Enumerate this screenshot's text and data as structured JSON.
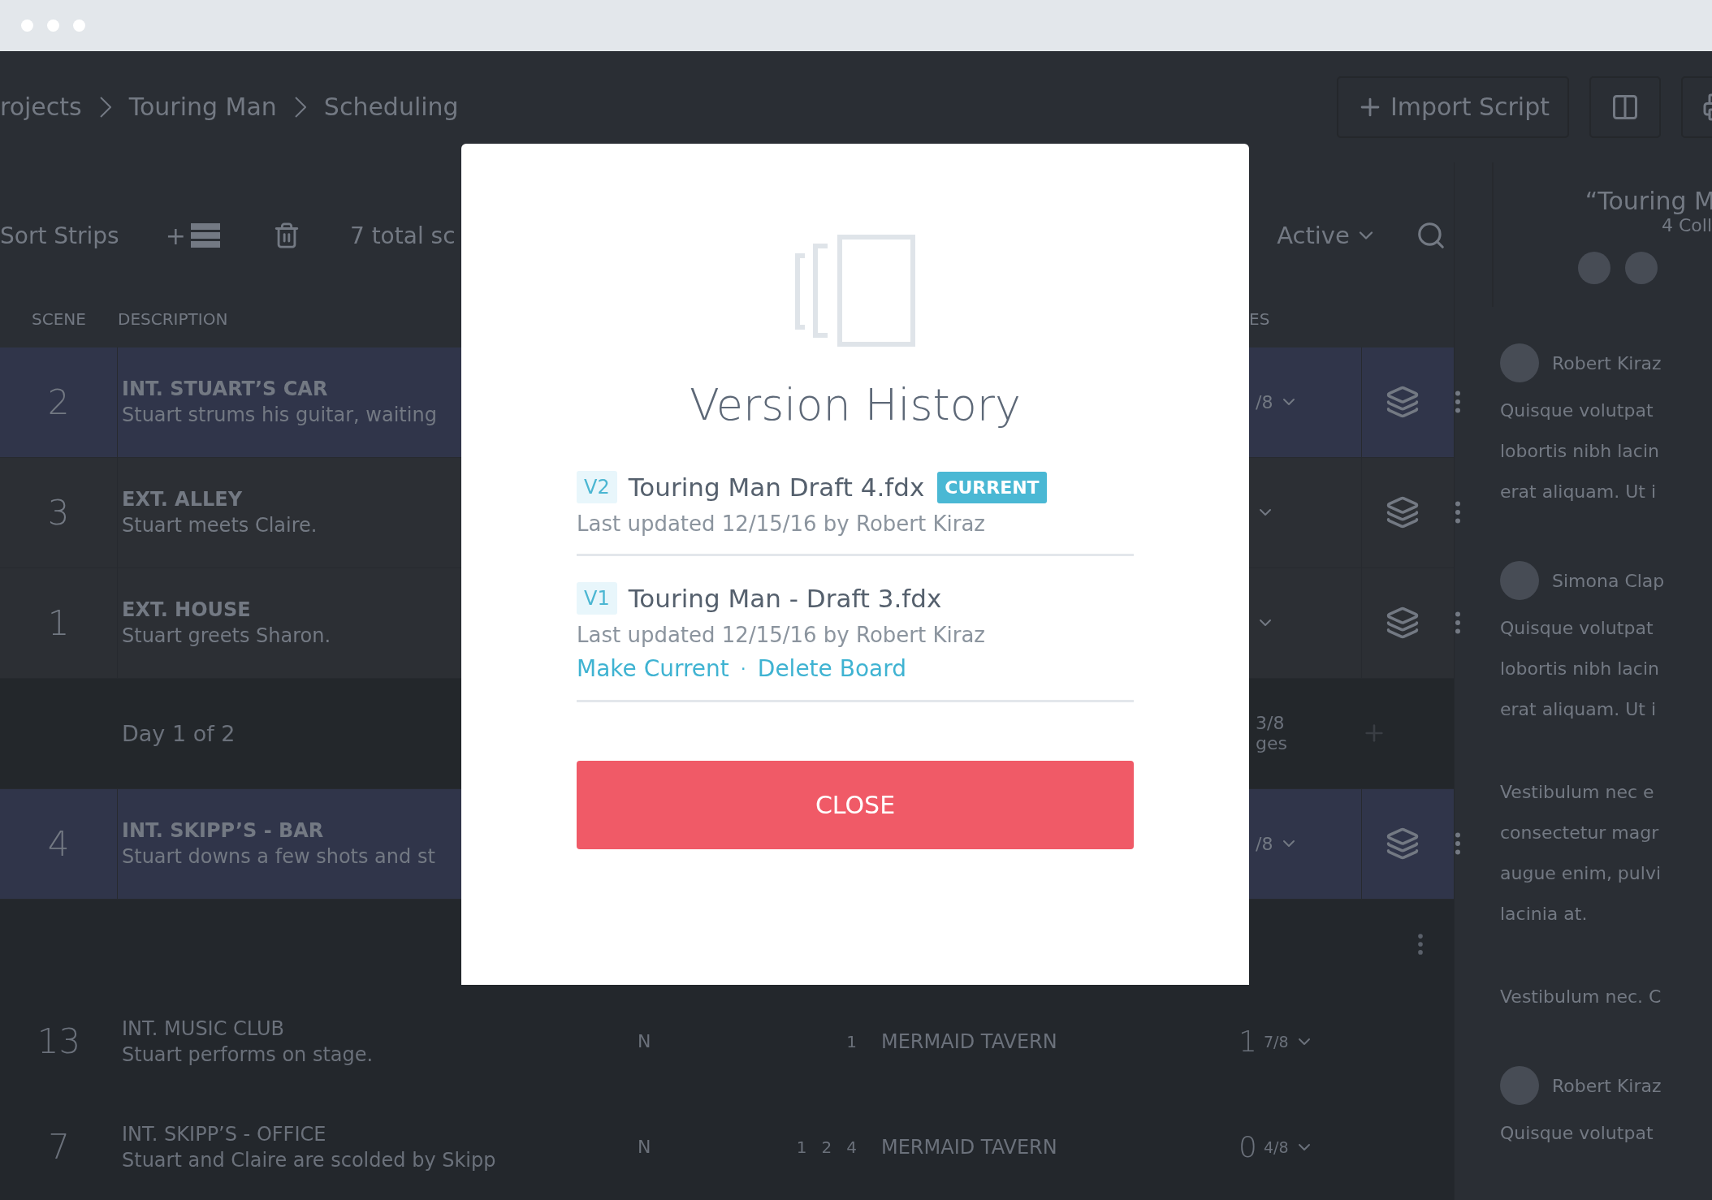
{
  "breadcrumb": [
    "rojects",
    "Touring Man",
    "Scheduling"
  ],
  "header": {
    "import_button": "Import Script"
  },
  "toolbar": {
    "sort": "Sort Strips",
    "add": "+",
    "total": "7 total sc",
    "filter": "Active"
  },
  "columns": [
    "SCENE",
    "DESCRIPTION",
    "ES"
  ],
  "strips": [
    {
      "kind": "scene",
      "selected": true,
      "number": "2",
      "title": "INT. STUART’S CAR",
      "description": "Stuart strums his guitar, waiting",
      "pages": "/8"
    },
    {
      "kind": "scene",
      "selected": false,
      "number": "3",
      "title": "EXT. ALLEY",
      "description": "Stuart meets Claire."
    },
    {
      "kind": "scene",
      "selected": false,
      "number": "1",
      "title": "EXT. HOUSE",
      "description": "Stuart greets Sharon."
    },
    {
      "kind": "day",
      "label": "Day 1 of 2",
      "pages": "3/8",
      "pages_label": "ges"
    },
    {
      "kind": "scene",
      "selected": true,
      "number": "4",
      "title": "INT. SKIPP’S - BAR",
      "description": "Stuart downs a few shots and st",
      "pages": "/8"
    }
  ],
  "unscheduled": [
    {
      "number": "13",
      "title": "INT. MUSIC CLUB",
      "description": "Stuart performs on stage.",
      "time": "N",
      "cast": [
        "1"
      ],
      "location": "MERMAID TAVERN",
      "pages_whole": "1",
      "pages_frac": "7/8"
    },
    {
      "number": "7",
      "title": "INT. SKIPP’S - OFFICE",
      "description": "Stuart and Claire are scolded by Skipp",
      "time": "N",
      "cast": [
        "1",
        "2",
        "4"
      ],
      "location": "MERMAID TAVERN",
      "pages_whole": "0",
      "pages_frac": "4/8"
    }
  ],
  "side_panel": {
    "title": "“Touring M",
    "subtitle": "4 Coll",
    "comments": [
      {
        "author": "Robert Kiraz",
        "paragraphs": [
          [
            "Quisque volutpat",
            "lobortis nibh lacin",
            "erat aliquam. Ut i"
          ]
        ]
      },
      {
        "author": "Simona Clap",
        "paragraphs": [
          [
            "Quisque volutpat",
            "lobortis nibh lacin",
            "erat aliquam. Ut i"
          ],
          [
            "Vestibulum nec e",
            "consectetur magr",
            "augue enim, pulvi",
            "lacinia at."
          ],
          [
            "Vestibulum nec. C"
          ]
        ]
      },
      {
        "author": "Robert Kiraz",
        "paragraphs": [
          [
            "Quisque volutpat"
          ]
        ]
      }
    ]
  },
  "modal": {
    "title": "Version History",
    "versions": [
      {
        "badge": "V2",
        "file": "Touring Man Draft 4.fdx",
        "status": "CURRENT",
        "updated": "Last updated 12/15/16 by Robert Kiraz"
      },
      {
        "badge": "V1",
        "file": "Touring Man - Draft 3.fdx",
        "updated": "Last updated 12/15/16 by Robert Kiraz",
        "actions": [
          "Make Current",
          "Delete Board"
        ],
        "action_separator": "·"
      }
    ],
    "close": "CLOSE"
  }
}
